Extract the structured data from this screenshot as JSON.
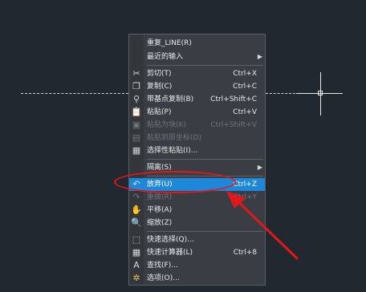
{
  "colors": {
    "background": "#212830",
    "menu_bg": "#3a3e44",
    "highlight": "#1f87d8",
    "annotation_red": "#e0181b"
  },
  "menu": {
    "items": [
      {
        "label": "重复_LINE(R)",
        "shortcut": "",
        "icon": "",
        "submenu": false,
        "disabled": false
      },
      {
        "label": "最近的输入",
        "shortcut": "",
        "icon": "",
        "submenu": true,
        "disabled": false
      },
      {
        "label": "剪切(T)",
        "shortcut": "Ctrl+X",
        "icon": "scissors-icon",
        "submenu": false,
        "disabled": false
      },
      {
        "label": "复制(C)",
        "shortcut": "Ctrl+C",
        "icon": "copy-icon",
        "submenu": false,
        "disabled": false
      },
      {
        "label": "带基点复制(B)",
        "shortcut": "Ctrl+Shift+C",
        "icon": "copy-basepoint-icon",
        "submenu": false,
        "disabled": false
      },
      {
        "label": "粘贴(P)",
        "shortcut": "Ctrl+V",
        "icon": "paste-icon",
        "submenu": false,
        "disabled": false
      },
      {
        "label": "粘贴为块(K)",
        "shortcut": "Ctrl+Shift+V",
        "icon": "paste-block-icon",
        "submenu": false,
        "disabled": true
      },
      {
        "label": "粘贴到原坐标(D)",
        "shortcut": "",
        "icon": "paste-original-icon",
        "submenu": false,
        "disabled": true
      },
      {
        "label": "选择性粘贴(I)...",
        "shortcut": "",
        "icon": "paste-special-icon",
        "submenu": false,
        "disabled": false
      },
      {
        "label": "隔离(S)",
        "shortcut": "",
        "icon": "",
        "submenu": true,
        "disabled": false
      },
      {
        "label": "放弃(U)",
        "shortcut": "Ctrl+Z",
        "icon": "undo-icon",
        "submenu": false,
        "disabled": false,
        "highlight": true
      },
      {
        "label": "重做(R)",
        "shortcut": "Ctrl+Y",
        "icon": "redo-icon",
        "submenu": false,
        "disabled": true
      },
      {
        "label": "平移(A)",
        "shortcut": "",
        "icon": "pan-icon",
        "submenu": false,
        "disabled": false
      },
      {
        "label": "缩放(Z)",
        "shortcut": "",
        "icon": "zoom-icon",
        "submenu": false,
        "disabled": false
      },
      {
        "label": "快速选择(Q)...",
        "shortcut": "",
        "icon": "quick-select-icon",
        "submenu": false,
        "disabled": false
      },
      {
        "label": "快速计算器(L)",
        "shortcut": "Ctrl+8",
        "icon": "calculator-icon",
        "submenu": false,
        "disabled": false
      },
      {
        "label": "查找(F)...",
        "shortcut": "",
        "icon": "find-icon",
        "submenu": false,
        "disabled": false
      },
      {
        "label": "选项(O)...",
        "shortcut": "",
        "icon": "options-icon",
        "submenu": false,
        "disabled": false
      }
    ]
  }
}
